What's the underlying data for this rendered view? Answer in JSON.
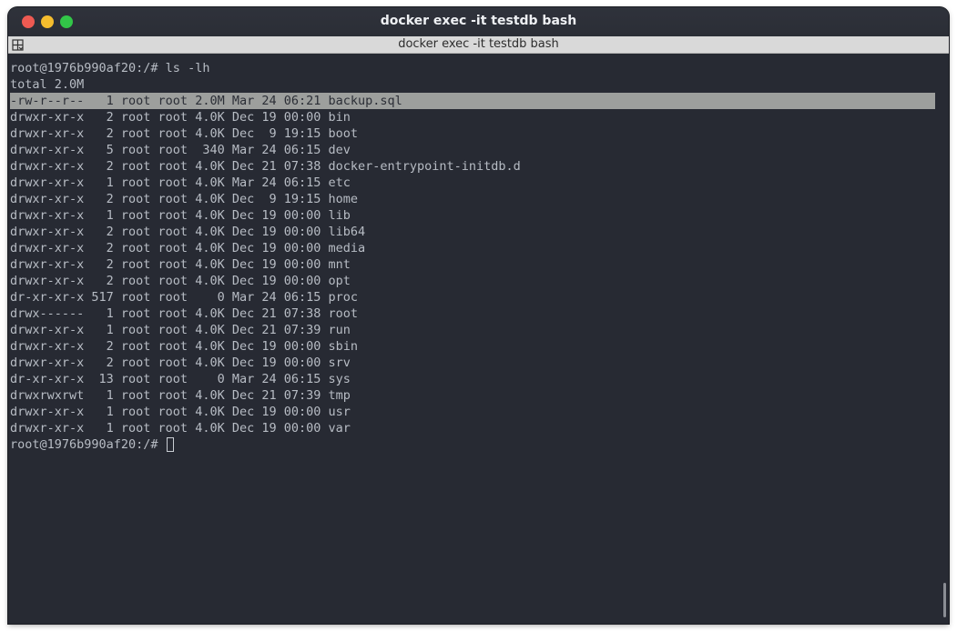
{
  "window": {
    "title": "docker exec -it testdb bash"
  },
  "tab": {
    "title": "docker exec -it testdb bash",
    "menu_icon": "tab-menu-icon"
  },
  "terminal": {
    "lines": [
      "root@1976b990af20:/# ls -lh",
      "total 2.0M",
      "-rw-r--r--   1 root root 2.0M Mar 24 06:21 backup.sql",
      "drwxr-xr-x   2 root root 4.0K Dec 19 00:00 bin",
      "drwxr-xr-x   2 root root 4.0K Dec  9 19:15 boot",
      "drwxr-xr-x   5 root root  340 Mar 24 06:15 dev",
      "drwxr-xr-x   2 root root 4.0K Dec 21 07:38 docker-entrypoint-initdb.d",
      "drwxr-xr-x   1 root root 4.0K Mar 24 06:15 etc",
      "drwxr-xr-x   2 root root 4.0K Dec  9 19:15 home",
      "drwxr-xr-x   1 root root 4.0K Dec 19 00:00 lib",
      "drwxr-xr-x   2 root root 4.0K Dec 19 00:00 lib64",
      "drwxr-xr-x   2 root root 4.0K Dec 19 00:00 media",
      "drwxr-xr-x   2 root root 4.0K Dec 19 00:00 mnt",
      "drwxr-xr-x   2 root root 4.0K Dec 19 00:00 opt",
      "dr-xr-xr-x 517 root root    0 Mar 24 06:15 proc",
      "drwx------   1 root root 4.0K Dec 21 07:38 root",
      "drwxr-xr-x   1 root root 4.0K Dec 21 07:39 run",
      "drwxr-xr-x   2 root root 4.0K Dec 19 00:00 sbin",
      "drwxr-xr-x   2 root root 4.0K Dec 19 00:00 srv",
      "dr-xr-xr-x  13 root root    0 Mar 24 06:15 sys",
      "drwxrwxrwt   1 root root 4.0K Dec 21 07:39 tmp",
      "drwxr-xr-x   1 root root 4.0K Dec 19 00:00 usr",
      "drwxr-xr-x   1 root root 4.0K Dec 19 00:00 var"
    ],
    "prompt": "root@1976b990af20:/# ",
    "highlighted_line": 2
  },
  "colors": {
    "background": "#272a33",
    "foreground": "#b7bcc4",
    "selection": "#9d9f9d"
  }
}
